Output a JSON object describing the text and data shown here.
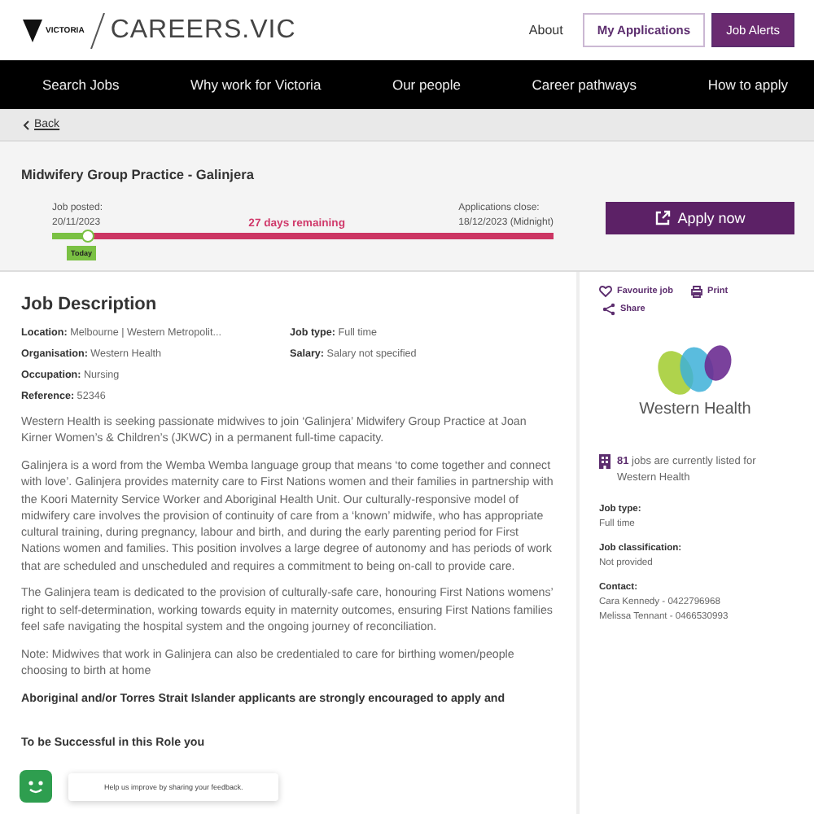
{
  "header": {
    "logo_text": "VICTORIA",
    "site_name": "CAREERS.VIC",
    "links": [
      {
        "label": "About",
        "kind": "link"
      },
      {
        "label": "My Applications",
        "kind": "outline"
      },
      {
        "label": "Job Alerts",
        "kind": "filled"
      }
    ]
  },
  "nav": [
    "Search Jobs",
    "Why work for Victoria",
    "Our people",
    "Career pathways",
    "How to apply"
  ],
  "back_link": "Back",
  "job": {
    "title": "Midwifery Group Practice - Galinjera",
    "posted_label": "Job posted:",
    "posted_date": "20/11/2023",
    "remaining": "27 days remaining",
    "close_label": "Applications close:",
    "close_date": "18/12/2023 (Midnight)",
    "level": 0.07,
    "today_label": "Today",
    "apply_button": "Apply now"
  },
  "description": {
    "heading": "Job Description",
    "fields_left": [
      {
        "label": "Location:",
        "value": "Melbourne | Western Metropolit..."
      },
      {
        "label": "Organisation:",
        "value": "Western Health"
      },
      {
        "label": "Occupation:",
        "value": "Nursing"
      },
      {
        "label": "Reference:",
        "value": "52346"
      }
    ],
    "fields_right": [
      {
        "label": "Job type:",
        "value": "Full time"
      },
      {
        "label": "Salary:",
        "value": "Salary not specified"
      }
    ],
    "paragraphs": [
      {
        "kind": "normal",
        "text": "Western Health is seeking passionate midwives to join ‘Galinjera’ Midwifery Group Practice at Joan Kirner Women’s & Children’s (JKWC) in a permanent full-time capacity."
      },
      {
        "kind": "normal",
        "text": "Galinjera is a word from the Wemba Wemba language group that means ‘to come together and connect with love’. Galinjera provides maternity care to First Nations women and their families in partnership with the Koori Maternity Service Worker and Aboriginal Health Unit. Our culturally-responsive model of midwifery care involves the provision of continuity of care from a ‘known’ midwife, who has appropriate cultural training, during pregnancy, labour and birth, and during the early parenting period for First Nations women and families. This position involves a large degree of autonomy and has periods of work that are scheduled and unscheduled and requires a commitment to being on-call to provide care."
      },
      {
        "kind": "normal",
        "text": "The Galinjera team is dedicated to the provision of culturally-safe care, honouring First Nations womens’ right to self-determination, working towards equity in maternity outcomes, ensuring First Nations families feel safe navigating the hospital system and the ongoing journey of reconciliation."
      },
      {
        "kind": "normal",
        "text": "Note: Midwives that work in Galinjera can also be credentialed to care for birthing women/people choosing to birth at home"
      },
      {
        "kind": "covered",
        "text": "Aboriginal and/or Torres Strait Islander applicants are strongly encouraged to apply and"
      },
      {
        "kind": "subheading",
        "text": "To be Successful in this Role you"
      }
    ]
  },
  "sidebar": {
    "actions": [
      {
        "kind": "heart",
        "label": "Favourite job"
      },
      {
        "kind": "printer",
        "label": "Print"
      },
      {
        "kind": "share",
        "label": "Share"
      }
    ],
    "employer": "Western Health",
    "jobs_count": "**81** jobs are currently listed for Western Health",
    "details": [
      {
        "label": "Job type:",
        "values": [
          "Full time"
        ]
      },
      {
        "label": "Job classification:",
        "values": [
          "Not provided"
        ]
      },
      {
        "label": "Contact:",
        "values": [
          "Cara Kennedy - 0422796968",
          "Melissa Tennant - 0466530993"
        ]
      }
    ]
  },
  "feedback": {
    "message": "Help us improve by sharing your feedback."
  }
}
